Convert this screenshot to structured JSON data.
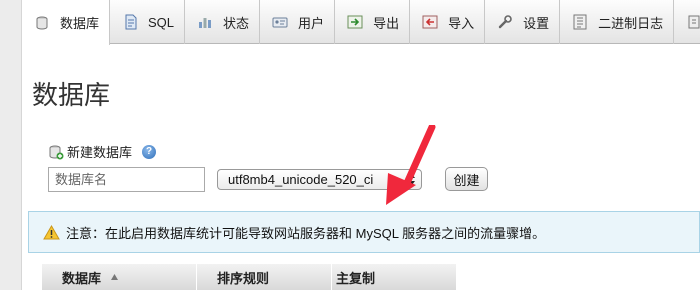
{
  "tabs": [
    {
      "label": "数据库",
      "icon": "database-icon",
      "active": true
    },
    {
      "label": "SQL",
      "icon": "sql-doc-icon",
      "active": false
    },
    {
      "label": "状态",
      "icon": "status-chart-icon",
      "active": false
    },
    {
      "label": "用户",
      "icon": "users-icon",
      "active": false
    },
    {
      "label": "导出",
      "icon": "export-icon",
      "active": false
    },
    {
      "label": "导入",
      "icon": "import-icon",
      "active": false
    },
    {
      "label": "设置",
      "icon": "wrench-icon",
      "active": false
    },
    {
      "label": "二进制日志",
      "icon": "binary-log-icon",
      "active": false
    }
  ],
  "page": {
    "title": "数据库"
  },
  "create_db": {
    "label": "新建数据库",
    "name_placeholder": "数据库名",
    "collation_value": "utf8mb4_unicode_520_ci",
    "create_button": "创建"
  },
  "notice": {
    "text": "注意：在此启用数据库统计可能导致网站服务器和 MySQL 服务器之间的流量骤增。"
  },
  "table": {
    "headers": [
      "数据库",
      "排序规则",
      "主复制"
    ]
  },
  "colors": {
    "annotation_arrow": "#f0283c",
    "notice_bg": "#eaf5fa",
    "notice_border": "#a9d3e6"
  }
}
